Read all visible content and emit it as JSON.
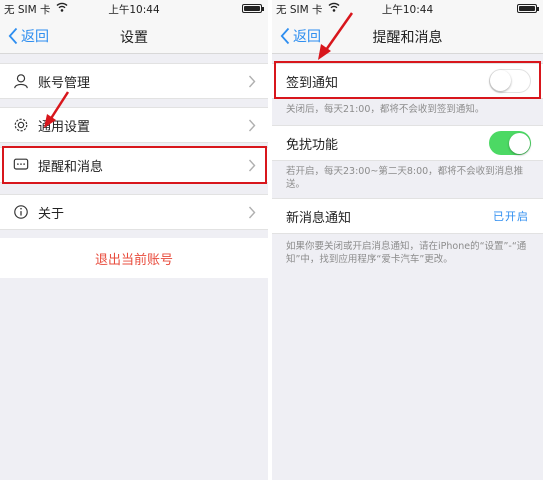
{
  "left": {
    "status": {
      "carrier": "无 SIM 卡",
      "time": "上午10:44"
    },
    "nav": {
      "back": "返回",
      "title": "设置"
    },
    "items": [
      {
        "label": "账号管理",
        "icon": "person-icon"
      },
      {
        "label": "通用设置",
        "icon": "gear-icon"
      },
      {
        "label": "提醒和消息",
        "icon": "chat-bubble-icon"
      },
      {
        "label": "关于",
        "icon": "info-icon"
      }
    ],
    "logout": "退出当前账号"
  },
  "right": {
    "status": {
      "carrier": "无 SIM 卡",
      "time": "上午10:44"
    },
    "nav": {
      "back": "返回",
      "title": "提醒和消息"
    },
    "signin": {
      "label": "签到通知",
      "enabled": false,
      "note": "关闭后，每天21:00，都将不会收到签到通知。"
    },
    "dnd": {
      "label": "免扰功能",
      "enabled": true,
      "note": "若开启，每天23:00~第二天8:00，都将不会收到消息推送。"
    },
    "newmsg": {
      "label": "新消息通知",
      "value": "已开启",
      "note": "如果你要关闭或开启消息通知，请在iPhone的“设置”-“通知”中，找到应用程序“爱卡汽车”更改。"
    }
  },
  "colors": {
    "accent": "#2e8ef0",
    "highlight": "#d8161c",
    "toggle_on": "#4cd964",
    "logout": "#e84c3d"
  }
}
